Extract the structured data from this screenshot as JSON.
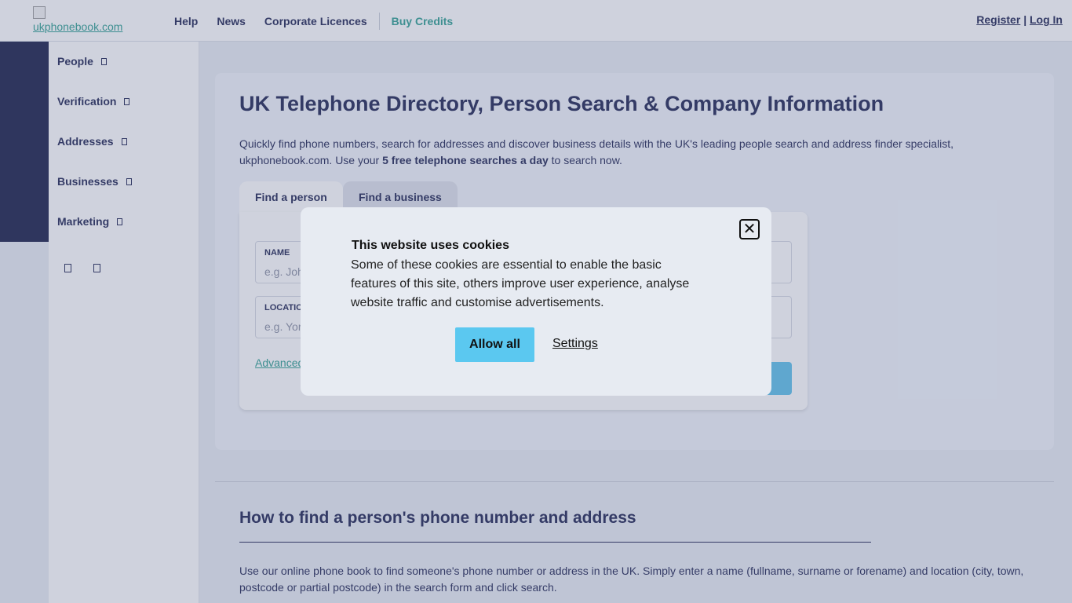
{
  "header": {
    "logo_alt": "ukphonebook.com",
    "nav": [
      "Help",
      "News",
      "Corporate Licences",
      "Buy Credits"
    ],
    "register": "Register",
    "auth_sep": "|",
    "login": "Log In"
  },
  "sidebar": {
    "items": [
      {
        "label": "People",
        "icon": "chevron-down-icon"
      },
      {
        "label": "Verification",
        "icon": "chevron-down-icon"
      },
      {
        "label": "Addresses",
        "icon": "chevron-down-icon"
      },
      {
        "label": "Businesses",
        "icon": "chevron-down-icon"
      },
      {
        "label": "Marketing",
        "icon": "chevron-down-icon"
      }
    ],
    "bottom_icons": [
      "social-icon",
      "social-icon"
    ]
  },
  "hero": {
    "title": "UK Telephone Directory, Person Search & Company Information",
    "intro_before": "Quickly find phone numbers, search for addresses and discover business details with the UK's leading people search and address finder specialist, ukphonebook.com. Use your ",
    "intro_bold": "5 free telephone searches a day",
    "intro_after": " to search now.",
    "tabs": [
      "Find a person",
      "Find a business"
    ],
    "fields": [
      {
        "label": "NAME",
        "placeholder": "e.g. John Smith"
      },
      {
        "label": "LOCATION",
        "placeholder": "e.g. York"
      }
    ],
    "advanced_link": "Advanced"
  },
  "howto": {
    "title": "How to find a person's phone number and address",
    "text": "Use our online phone book to find someone's phone number or address in the UK. Simply enter a name (fullname, surname or forename) and location (city, town, postcode or partial postcode) in the search form and click search."
  },
  "cookie_modal": {
    "title": "This website uses cookies",
    "body": "Some of these cookies are essential to enable the basic features of this site, others improve user experience, analyse website traffic and customise advertisements.",
    "allow_label": "Allow all",
    "settings_label": "Settings",
    "close_symbol": "✕"
  },
  "colors": {
    "navy": "#1b2150",
    "teal": "#2a9d8f",
    "accent_blue": "#5bc8f0",
    "sidebar_dark": "#141a45"
  }
}
